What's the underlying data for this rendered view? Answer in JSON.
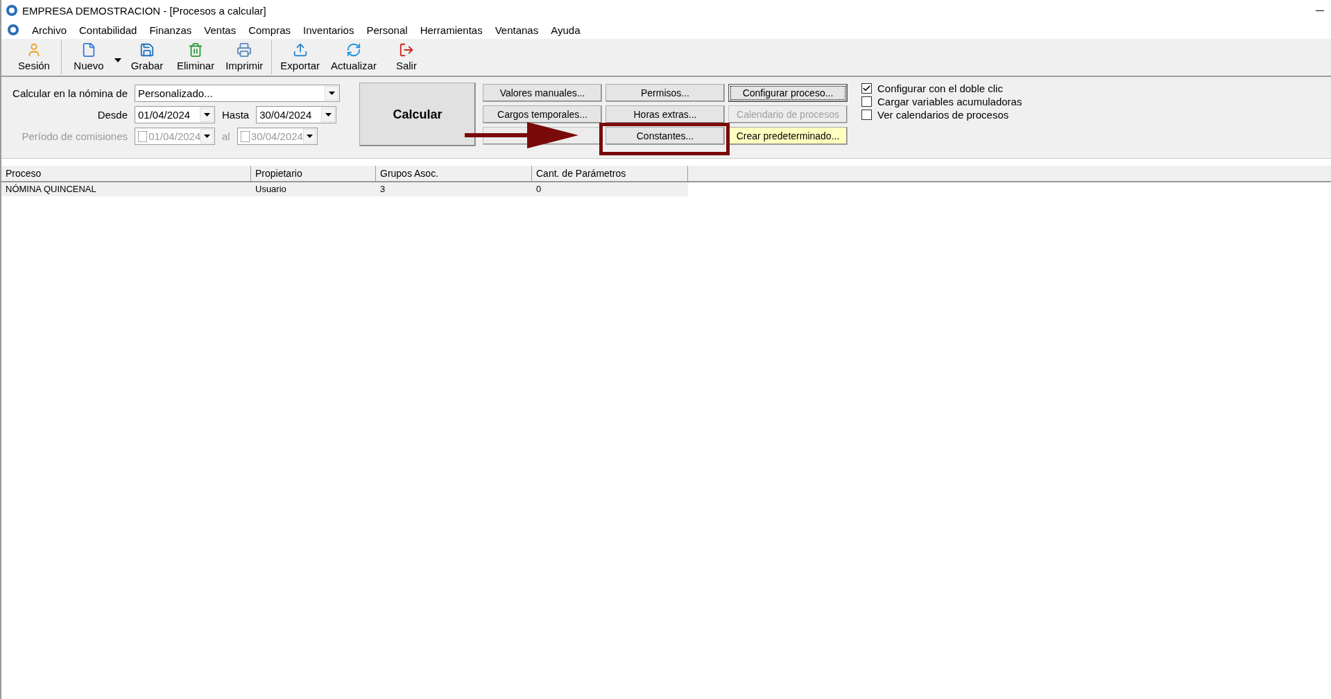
{
  "window": {
    "title": "EMPRESA DEMOSTRACION - [Procesos a calcular]"
  },
  "menu": [
    "Archivo",
    "Contabilidad",
    "Finanzas",
    "Ventas",
    "Compras",
    "Inventarios",
    "Personal",
    "Herramientas",
    "Ventanas",
    "Ayuda"
  ],
  "toolbar": [
    [
      {
        "label": "Sesión",
        "kind": "session"
      }
    ],
    [
      {
        "label": "Nuevo",
        "kind": "new",
        "has_menu": true
      },
      {
        "label": "Grabar",
        "kind": "save"
      },
      {
        "label": "Eliminar",
        "kind": "delete"
      },
      {
        "label": "Imprimir",
        "kind": "print"
      }
    ],
    [
      {
        "label": "Exportar",
        "kind": "export"
      },
      {
        "label": "Actualizar",
        "kind": "refresh"
      },
      {
        "label": "Salir",
        "kind": "exit"
      }
    ]
  ],
  "form": {
    "nomina": {
      "label": "Calcular en la nómina de",
      "value": "Personalizado..."
    },
    "desde": {
      "label": "Desde",
      "value": "01/04/2024"
    },
    "hasta": {
      "label": "Hasta",
      "value": "30/04/2024"
    },
    "periodo": {
      "label": "Período de comisiones",
      "disabled": true,
      "from": {
        "value": "01/04/2024",
        "checked": false
      },
      "al_label": "al",
      "to": {
        "value": "30/04/2024",
        "checked": false
      }
    }
  },
  "calculate_button": {
    "label": "Calcular"
  },
  "buttons": [
    {
      "label": "Valores manuales...",
      "disabled": false,
      "kind": "normal"
    },
    {
      "label": "Cargos temporales...",
      "disabled": false,
      "kind": "normal"
    },
    {
      "disabled": true,
      "kind": "normal"
    },
    {
      "label": "Permisos...",
      "disabled": false,
      "kind": "normal"
    },
    {
      "label": "Horas extras...",
      "disabled": false,
      "kind": "normal"
    },
    {
      "label": "Constantes...",
      "disabled": false,
      "kind": "normal"
    },
    {
      "label": "Configurar proceso...",
      "disabled": false,
      "kind": "focused"
    },
    {
      "label": "Calendario de procesos",
      "disabled": true,
      "kind": "normal"
    },
    {
      "label": "Crear predeterminado...",
      "disabled": false,
      "kind": "accent"
    }
  ],
  "options": [
    {
      "label": "Configurar con el doble clic",
      "checked": true
    },
    {
      "label": "Cargar variables acumuladoras",
      "checked": false
    },
    {
      "label": "Ver calendarios de procesos",
      "checked": false
    }
  ],
  "table": {
    "columns": [
      "Proceso",
      "Propietario",
      "Grupos Asoc.",
      "Cant. de Parámetros"
    ],
    "rows": [
      [
        "NÓMINA QUINCENAL",
        "Usuario",
        "3",
        "0"
      ]
    ]
  }
}
